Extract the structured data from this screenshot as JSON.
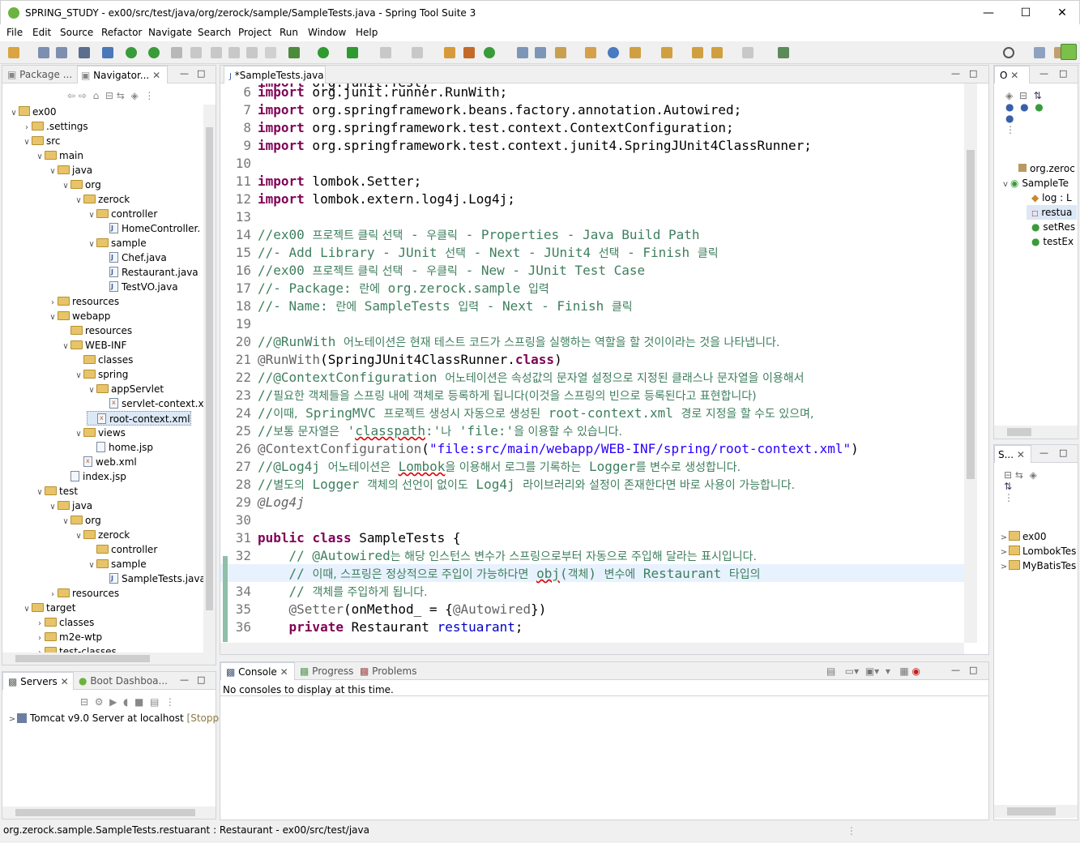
{
  "window": {
    "title": "SPRING_STUDY - ex00/src/test/java/org/zerock/sample/SampleTests.java - Spring Tool Suite 3"
  },
  "menu": [
    "File",
    "Edit",
    "Source",
    "Refactor",
    "Navigate",
    "Search",
    "Project",
    "Run",
    "Window",
    "Help"
  ],
  "left_panel": {
    "tabs": [
      "Package ...",
      "Navigator..."
    ],
    "tree": [
      {
        "label": "ex00",
        "depth": 0,
        "icon": "project",
        "exp": "v"
      },
      {
        "label": ".settings",
        "depth": 1,
        "icon": "folder",
        "exp": ">"
      },
      {
        "label": "src",
        "depth": 1,
        "icon": "folder",
        "exp": "v"
      },
      {
        "label": "main",
        "depth": 2,
        "icon": "folder",
        "exp": "v"
      },
      {
        "label": "java",
        "depth": 3,
        "icon": "folder",
        "exp": "v"
      },
      {
        "label": "org",
        "depth": 4,
        "icon": "folder",
        "exp": "v"
      },
      {
        "label": "zerock",
        "depth": 5,
        "icon": "folder",
        "exp": "v"
      },
      {
        "label": "controller",
        "depth": 6,
        "icon": "folder",
        "exp": "v"
      },
      {
        "label": "HomeController.",
        "depth": 7,
        "icon": "java",
        "exp": ""
      },
      {
        "label": "sample",
        "depth": 6,
        "icon": "folder",
        "exp": "v"
      },
      {
        "label": "Chef.java",
        "depth": 7,
        "icon": "java",
        "exp": ""
      },
      {
        "label": "Restaurant.java",
        "depth": 7,
        "icon": "java",
        "exp": ""
      },
      {
        "label": "TestVO.java",
        "depth": 7,
        "icon": "java",
        "exp": ""
      },
      {
        "label": "resources",
        "depth": 3,
        "icon": "folder",
        "exp": ">"
      },
      {
        "label": "webapp",
        "depth": 3,
        "icon": "folder",
        "exp": "v"
      },
      {
        "label": "resources",
        "depth": 4,
        "icon": "folder",
        "exp": ""
      },
      {
        "label": "WEB-INF",
        "depth": 4,
        "icon": "folder",
        "exp": "v"
      },
      {
        "label": "classes",
        "depth": 5,
        "icon": "folder",
        "exp": ""
      },
      {
        "label": "spring",
        "depth": 5,
        "icon": "folder",
        "exp": "v"
      },
      {
        "label": "appServlet",
        "depth": 6,
        "icon": "folder",
        "exp": "v"
      },
      {
        "label": "servlet-context.xı",
        "depth": 7,
        "icon": "xml",
        "exp": ""
      },
      {
        "label": "root-context.xml",
        "depth": 6,
        "icon": "xml",
        "exp": "",
        "selected": true
      },
      {
        "label": "views",
        "depth": 5,
        "icon": "folder",
        "exp": "v"
      },
      {
        "label": "home.jsp",
        "depth": 6,
        "icon": "file",
        "exp": ""
      },
      {
        "label": "web.xml",
        "depth": 5,
        "icon": "xml",
        "exp": ""
      },
      {
        "label": "index.jsp",
        "depth": 4,
        "icon": "file",
        "exp": ""
      },
      {
        "label": "test",
        "depth": 2,
        "icon": "folder",
        "exp": "v"
      },
      {
        "label": "java",
        "depth": 3,
        "icon": "folder",
        "exp": "v"
      },
      {
        "label": "org",
        "depth": 4,
        "icon": "folder",
        "exp": "v"
      },
      {
        "label": "zerock",
        "depth": 5,
        "icon": "folder",
        "exp": "v"
      },
      {
        "label": "controller",
        "depth": 6,
        "icon": "folder",
        "exp": ""
      },
      {
        "label": "sample",
        "depth": 6,
        "icon": "folder",
        "exp": "v"
      },
      {
        "label": "SampleTests.java",
        "depth": 7,
        "icon": "java",
        "exp": ""
      },
      {
        "label": "resources",
        "depth": 3,
        "icon": "folder",
        "exp": ">"
      },
      {
        "label": "target",
        "depth": 1,
        "icon": "folder",
        "exp": "v"
      },
      {
        "label": "classes",
        "depth": 2,
        "icon": "folder",
        "exp": ">"
      },
      {
        "label": "m2e-wtp",
        "depth": 2,
        "icon": "folder",
        "exp": ">"
      },
      {
        "label": "test-classes",
        "depth": 2,
        "icon": "folder",
        "exp": ">"
      }
    ]
  },
  "servers": {
    "tabs": [
      "Servers",
      "Boot Dashboa..."
    ],
    "item": "Tomcat v9.0 Server at localhost",
    "status": "[Stoppe"
  },
  "editor": {
    "tab": "*SampleTests.java",
    "line_numbers": [
      "6",
      "7",
      "8",
      "9",
      "10",
      "11",
      "12",
      "13",
      "14",
      "15",
      "16",
      "17",
      "18",
      "19",
      "20",
      "21",
      "22",
      "23",
      "24",
      "25",
      "26",
      "27",
      "28",
      "29",
      "30",
      "31",
      "32",
      "33",
      "34",
      "35",
      "36"
    ]
  },
  "console": {
    "tabs": [
      "Console",
      "Progress",
      "Problems"
    ],
    "message": "No consoles to display at this time."
  },
  "outline": {
    "tab": "O",
    "items": [
      "org.zeroc",
      "SampleTe",
      "log : L",
      "restua",
      "setRes",
      "testEx"
    ]
  },
  "spring_explorer": {
    "tab": "S...",
    "items": [
      "ex00",
      "LombokTes",
      "MyBatisTes"
    ]
  },
  "status": {
    "text": "org.zerock.sample.SampleTests.restuarant : Restaurant - ex00/src/test/java"
  }
}
